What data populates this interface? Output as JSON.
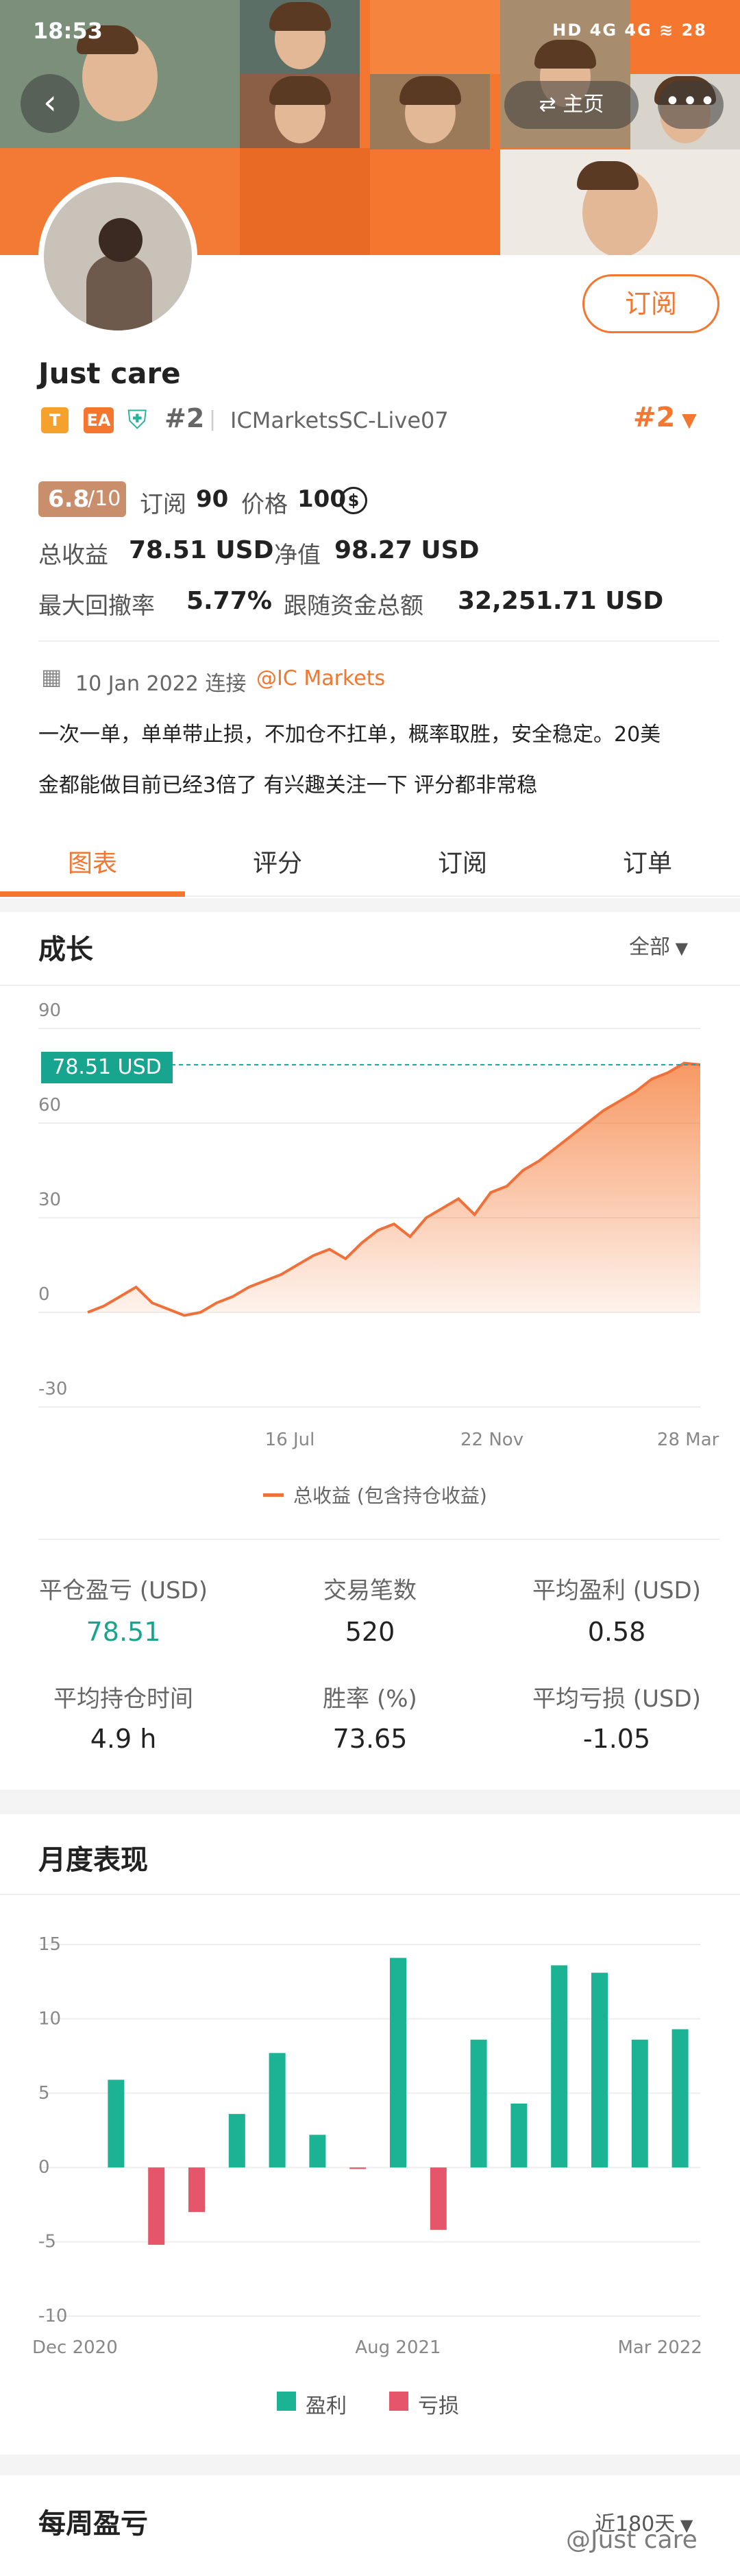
{
  "status_bar": {
    "time": "18:53",
    "icons": "HD 4G 4G ≋ 28"
  },
  "header": {
    "home_label": "主页",
    "more_label": "•••",
    "subscribe_label": "订阅"
  },
  "profile": {
    "name": "Just care",
    "badge_t": "T",
    "badge_ea": "EA",
    "rank": "#2",
    "server": "ICMarketsSC-Live07",
    "rank_right": "#2",
    "rating": "6.8",
    "rating_max": "/10",
    "subscribers_label": "订阅",
    "subscribers": "90",
    "price_label": "价格",
    "price": "100",
    "total_profit_label": "总收益",
    "total_profit": "78.51 USD",
    "equity_label": "净值",
    "equity": "98.27 USD",
    "drawdown_label": "最大回撤率",
    "drawdown": "5.77%",
    "follow_funds_label": "跟随资金总额",
    "follow_funds": "32,251.71 USD",
    "connect_date": "10 Jan 2022 连接",
    "broker": "@IC Markets",
    "description_line1": "一次一单，单单带止损，不加仓不扛单，概率取胜，安全稳定。20美",
    "description_line2": "金都能做目前已经3倍了 有兴趣关注一下 评分都非常稳"
  },
  "tabs": [
    {
      "label": "图表",
      "active": true
    },
    {
      "label": "评分",
      "active": false
    },
    {
      "label": "订阅",
      "active": false
    },
    {
      "label": "订单",
      "active": false
    }
  ],
  "growth": {
    "title": "成长",
    "filter": "全部",
    "current_label": "78.51 USD",
    "legend": "总收益 (包含持仓收益)"
  },
  "stats": {
    "closed_pl_label": "平仓盈亏 (USD)",
    "closed_pl": "78.51",
    "trades_label": "交易笔数",
    "trades": "520",
    "avg_profit_label": "平均盈利 (USD)",
    "avg_profit": "0.58",
    "avg_hold_label": "平均持仓时间",
    "avg_hold": "4.9 h",
    "winrate_label": "胜率 (%)",
    "winrate": "73.65",
    "avg_loss_label": "平均亏损 (USD)",
    "avg_loss": "-1.05"
  },
  "monthly": {
    "title": "月度表现",
    "legend_profit": "盈利",
    "legend_loss": "亏损"
  },
  "weekly": {
    "title": "每周盈亏",
    "filter": "近180天"
  },
  "watermark": "@Just care",
  "colors": {
    "accent": "#f4762f",
    "profit": "#1bb394",
    "loss": "#e5566a"
  },
  "chart_data": [
    {
      "type": "area",
      "title": "",
      "ylim": [
        -30,
        90
      ],
      "yticks": [
        "90",
        "60",
        "30",
        "0",
        "-30"
      ],
      "xticks": [
        "16 Jul",
        "22 Nov",
        "28 Mar"
      ],
      "series": [
        {
          "name": "总收益 (包含持仓收益)",
          "values": [
            0,
            2,
            5,
            8,
            3,
            1,
            -1,
            0,
            3,
            5,
            8,
            10,
            12,
            15,
            18,
            20,
            17,
            22,
            26,
            28,
            24,
            30,
            33,
            36,
            31,
            38,
            40,
            45,
            48,
            52,
            56,
            60,
            64,
            67,
            70,
            74,
            76,
            79,
            78.51
          ]
        }
      ]
    },
    {
      "type": "bar",
      "title": "",
      "ylim": [
        -10,
        15
      ],
      "yticks": [
        "15",
        "10",
        "5",
        "0",
        "-5",
        "-10"
      ],
      "xticks": [
        "Dec 2020",
        "Aug 2021",
        "Mar 2022"
      ],
      "series": [
        {
          "name": "盈利",
          "values": [
            5.9,
            0,
            0,
            3.6,
            7.7,
            2.2,
            0,
            14.1,
            0,
            8.6,
            4.3,
            13.6,
            13.1,
            8.6,
            9.3
          ]
        },
        {
          "name": "亏损",
          "values": [
            0,
            -5.2,
            -3.0,
            0,
            0,
            0,
            -0.1,
            0,
            -4.2,
            0,
            0,
            0,
            0,
            0,
            0
          ]
        }
      ]
    }
  ]
}
